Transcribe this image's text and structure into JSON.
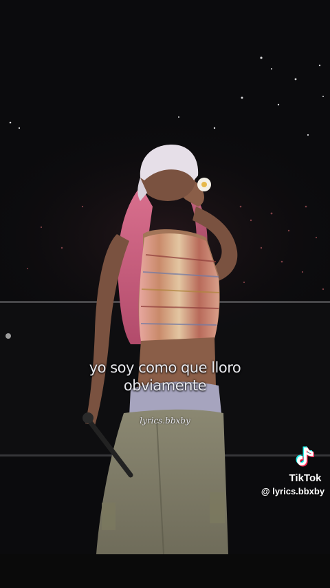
{
  "video": {
    "caption_line1": "yo soy como que lloro",
    "caption_line2": "obviamente",
    "center_watermark": "lyrics.bbxby"
  },
  "tiktok": {
    "icon": "tiktok-note-icon",
    "brand": "TikTok",
    "username": "@ lyrics.bbxby"
  },
  "colors": {
    "background": "#0b0b0d",
    "hair": "#d9708e",
    "tiktok_cyan": "#25f4ee",
    "tiktok_red": "#fe2c55"
  }
}
